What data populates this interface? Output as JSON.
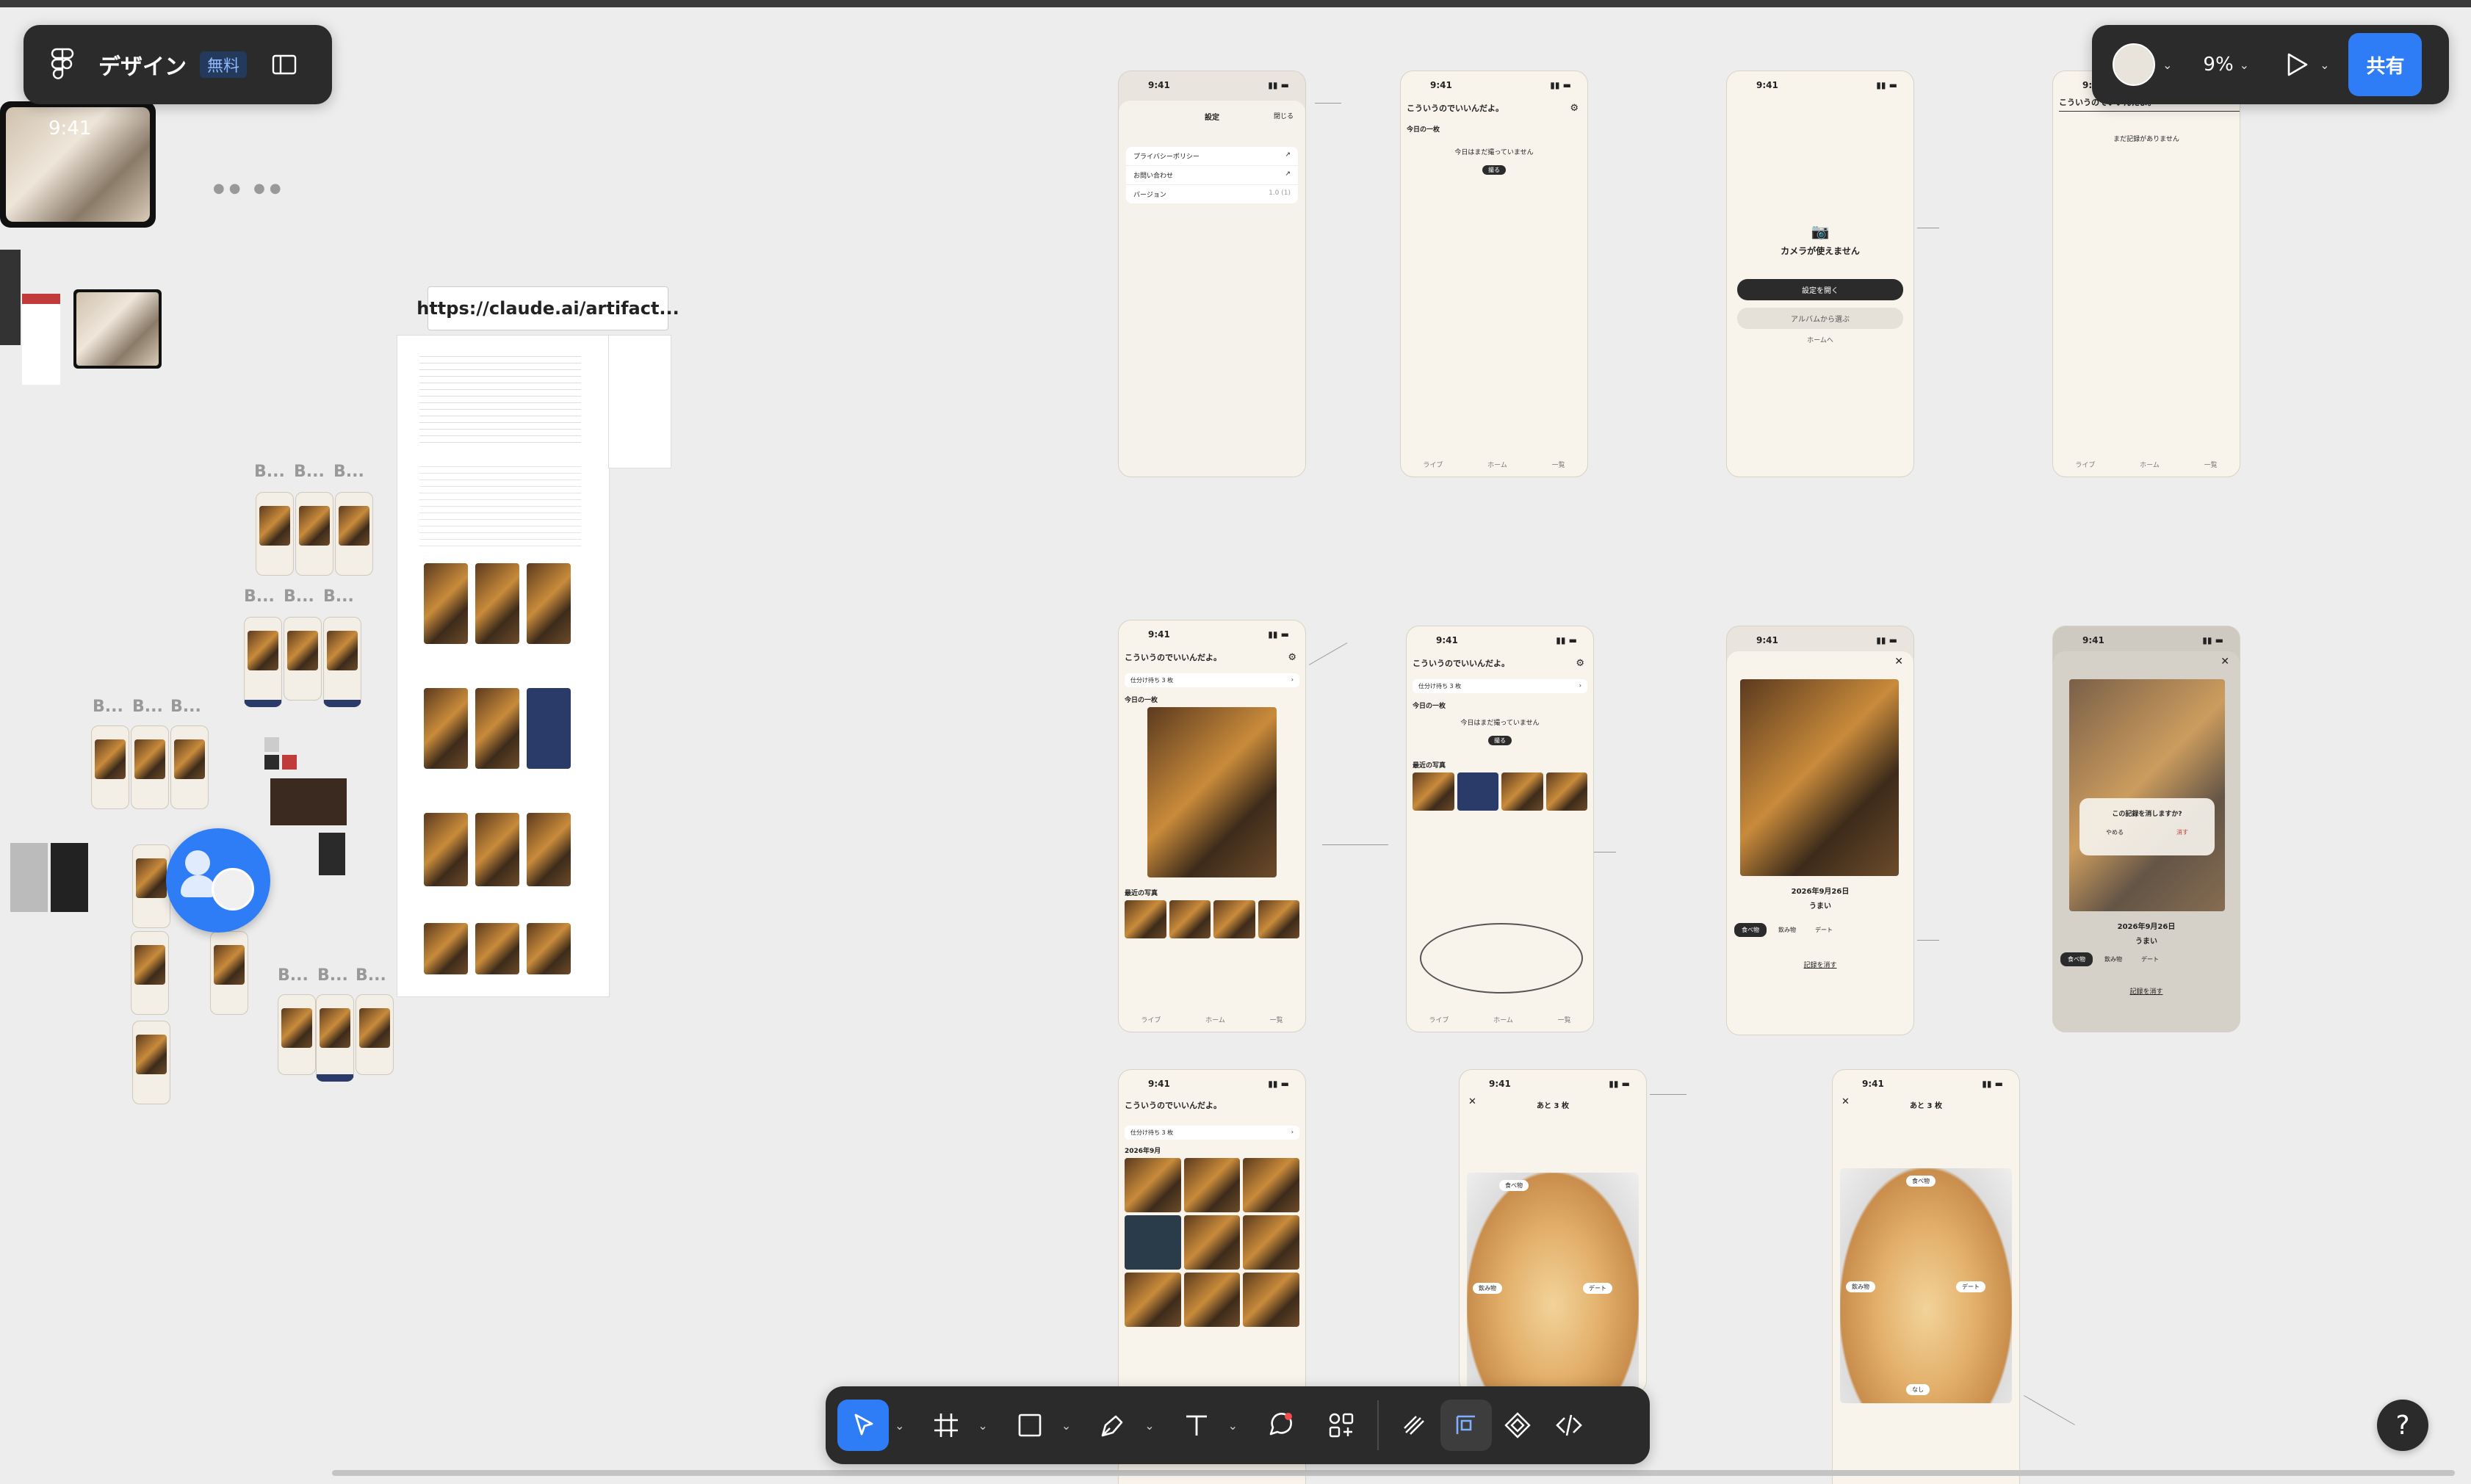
{
  "app": {
    "title": "デザイン",
    "plan_badge": "無料",
    "zoom": "9%",
    "share_label": "共有",
    "help_label": "?",
    "accent": "#2f7df6"
  },
  "canvas": {
    "url_label": "https://claude.ai/artifact...",
    "b_label": "B...",
    "status_time": "9:41",
    "app_title": "こういうのでいいんだよ。",
    "today_one": "今日の一枚",
    "not_taken": "今日はまだ撮っていません",
    "take": "撮る",
    "recent_photos": "最近の写真",
    "pending": "仕分け待ち 3 枚",
    "month": "2026年9月",
    "date": "2026年9月26日",
    "umai": "うまい",
    "settings": "設定",
    "close": "閉じる",
    "privacy": "プライバシーポリシー",
    "contact": "お問い合わせ",
    "version": "バージョン",
    "version_value": "1.0 (1)",
    "no_camera": "カメラが使えません",
    "open_settings": "設定を開く",
    "from_album": "アルバムから選ぶ",
    "home": "ホームへ",
    "no_records": "まだ記録がありません",
    "delete_confirm": "この記録を消しますか?",
    "cancel": "やめる",
    "delete": "消す",
    "delete_record": "記録を消す",
    "remaining": "あと 3 枚",
    "tag_eat": "食べ物",
    "tag_drink": "飲み物",
    "tag_date": "デート",
    "tag_none": "なし",
    "nav_tabs": [
      "ライブ",
      "ホーム",
      "一覧"
    ]
  }
}
